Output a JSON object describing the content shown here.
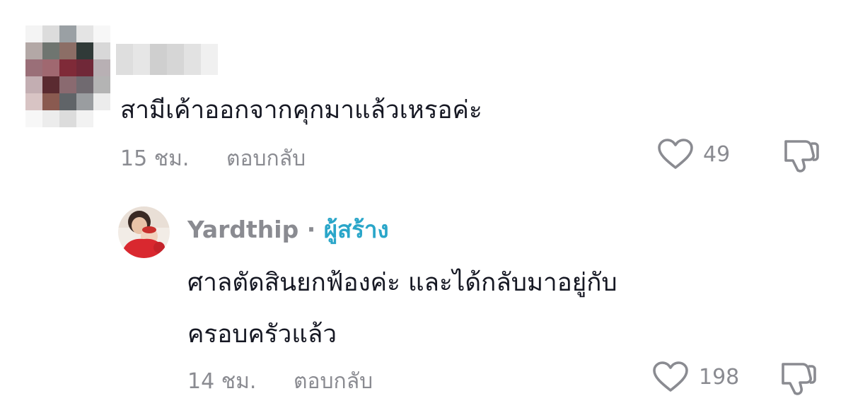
{
  "comment1": {
    "text": "สามีเค้าออกจากคุกมาแล้วเหรอค่ะ",
    "time": "15 ชม.",
    "reply_label": "ตอบกลับ",
    "likes": "49",
    "avatar_pixels": [
      "#f4f4f4",
      "#dcdcdc",
      "#9aa0a4",
      "#e4e4e4",
      "#f7f7f7",
      "#b3a8a6",
      "#6f7570",
      "#8c6e66",
      "#303a38",
      "#d8d8d8",
      "#9a6f78",
      "#a06870",
      "#7f2a38",
      "#702838",
      "#b8b0b4",
      "#c3aeb2",
      "#5a2a30",
      "#8a6a70",
      "#706a70",
      "#b4b4b4",
      "#d8c4c4",
      "#8a5a50",
      "#606468",
      "#9a9da0",
      "#ececec",
      "#f7f7f7",
      "#ececec",
      "#dcdcdc",
      "#f2f2f2",
      "#ffffff"
    ],
    "name_pixels": [
      "#dedede",
      "#e6e6e6",
      "#cfcfcf",
      "#d6d6d6",
      "#e2e2e2",
      "#f0f0f0"
    ]
  },
  "comment2": {
    "author": "Yardthip",
    "separator": " · ",
    "badge": "ผู้สร้าง",
    "text_line1": "ศาลตัดสินยกฟ้องค่ะ และได้กลับมาอยู่กับ",
    "text_line2": "ครอบครัวแล้ว",
    "time": "14 ชม.",
    "reply_label": "ตอบกลับ",
    "likes": "198"
  },
  "colors": {
    "text": "#161823",
    "secondary": "#8a8b91",
    "creator_badge": "#2aa6c9",
    "icon": "#8a8b91"
  },
  "icons": [
    "heart-icon",
    "thumbs-down-icon"
  ]
}
